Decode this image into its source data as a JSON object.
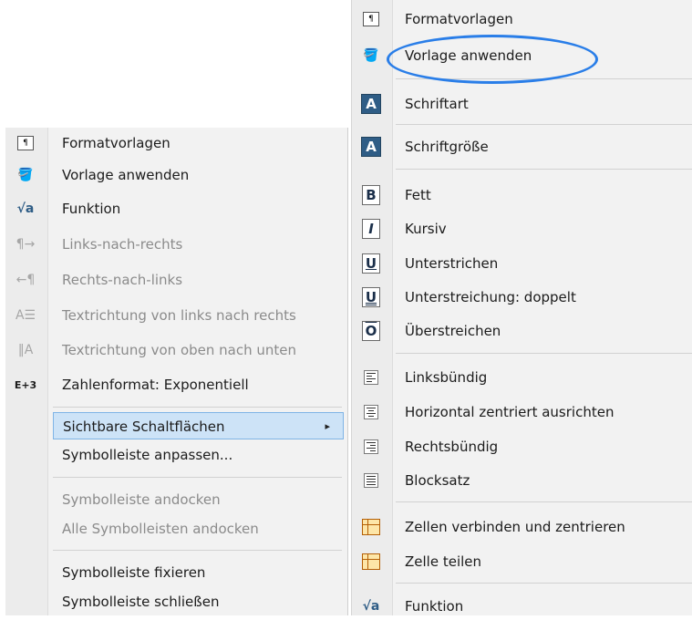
{
  "left_menu": {
    "items": [
      {
        "label": "Formatvorlagen",
        "icon": "styles-icon"
      },
      {
        "label": "Vorlage anwenden",
        "icon": "paint-bucket-icon"
      },
      {
        "label": "Funktion",
        "icon": "function-icon"
      },
      {
        "label": "Links-nach-rechts",
        "icon": "ltr-paragraph-icon"
      },
      {
        "label": "Rechts-nach-links",
        "icon": "rtl-paragraph-icon"
      },
      {
        "label": "Textrichtung von links nach rechts",
        "icon": "text-direction-ltr-icon"
      },
      {
        "label": "Textrichtung von oben nach unten",
        "icon": "text-direction-ttb-icon"
      },
      {
        "label": "Zahlenformat: Exponentiell",
        "icon": "exponential-format-icon",
        "icon_text": "E+3"
      },
      {
        "label": "Sichtbare Schaltflächen"
      },
      {
        "label": "Symbolleiste anpassen..."
      },
      {
        "label": "Symbolleiste andocken"
      },
      {
        "label": "Alle Symbolleisten andocken"
      },
      {
        "label": "Symbolleiste fixieren"
      },
      {
        "label": "Symbolleiste schließen"
      }
    ],
    "submenu_arrow": "▸"
  },
  "right_menu": {
    "items": [
      {
        "label": "Formatvorlagen",
        "icon": "styles-icon"
      },
      {
        "label": "Vorlage anwenden",
        "icon": "paint-bucket-icon"
      },
      {
        "label": "Schriftart",
        "icon": "font-name-icon",
        "icon_text": "A"
      },
      {
        "label": "Schriftgröße",
        "icon": "font-size-icon",
        "icon_text": "A"
      },
      {
        "label": "Fett",
        "icon": "bold-icon",
        "icon_text": "B"
      },
      {
        "label": "Kursiv",
        "icon": "italic-icon",
        "icon_text": "I"
      },
      {
        "label": "Unterstrichen",
        "icon": "underline-icon",
        "icon_text": "U"
      },
      {
        "label": "Unterstreichung: doppelt",
        "icon": "double-underline-icon",
        "icon_text": "U"
      },
      {
        "label": "Überstreichen",
        "icon": "overline-icon",
        "icon_text": "O"
      },
      {
        "label": "Linksbündig",
        "icon": "align-left-icon"
      },
      {
        "label": "Horizontal zentriert ausrichten",
        "icon": "align-center-icon"
      },
      {
        "label": "Rechtsbündig",
        "icon": "align-right-icon"
      },
      {
        "label": "Blocksatz",
        "icon": "justify-icon"
      },
      {
        "label": "Zellen verbinden und zentrieren",
        "icon": "merge-cells-icon"
      },
      {
        "label": "Zelle teilen",
        "icon": "split-cell-icon"
      },
      {
        "label": "Funktion",
        "icon": "function-icon"
      }
    ]
  },
  "colors": {
    "menu_bg": "#f2f2f2",
    "highlight_bg": "#cde3f7",
    "annotation": "#2a7ee8",
    "icon_blue": "#2f5d86"
  }
}
